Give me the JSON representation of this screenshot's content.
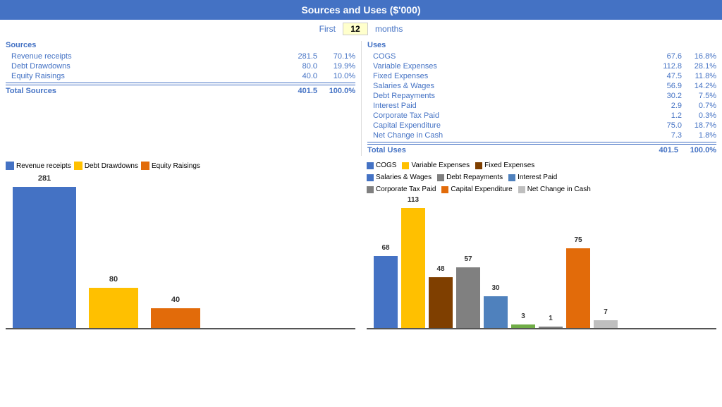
{
  "title": "Sources and Uses ($'000)",
  "months_label_pre": "First",
  "months_value": "12",
  "months_label_post": "months",
  "sources": {
    "header": "Sources",
    "items": [
      {
        "label": "Revenue receipts",
        "value": "281.5",
        "pct": "70.1%"
      },
      {
        "label": "Debt Drawdowns",
        "value": "80.0",
        "pct": "19.9%"
      },
      {
        "label": "Equity Raisings",
        "value": "40.0",
        "pct": "10.0%"
      }
    ],
    "total_label": "Total Sources",
    "total_value": "401.5",
    "total_pct": "100.0%"
  },
  "uses": {
    "header": "Uses",
    "items": [
      {
        "label": "COGS",
        "value": "67.6",
        "pct": "16.8%"
      },
      {
        "label": "Variable Expenses",
        "value": "112.8",
        "pct": "28.1%"
      },
      {
        "label": "Fixed Expenses",
        "value": "47.5",
        "pct": "11.8%"
      },
      {
        "label": "Salaries & Wages",
        "value": "56.9",
        "pct": "14.2%"
      },
      {
        "label": "Debt Repayments",
        "value": "30.2",
        "pct": "7.5%"
      },
      {
        "label": "Interest Paid",
        "value": "2.9",
        "pct": "0.7%"
      },
      {
        "label": "Corporate Tax Paid",
        "value": "1.2",
        "pct": "0.3%"
      },
      {
        "label": "Capital Expenditure",
        "value": "75.0",
        "pct": "18.7%"
      },
      {
        "label": "Net Change in Cash",
        "value": "7.3",
        "pct": "1.8%"
      }
    ],
    "total_label": "Total Uses",
    "total_value": "401.5",
    "total_pct": "100.0%"
  },
  "left_chart": {
    "legend": [
      {
        "label": "Revenue receipts",
        "color": "#4472C4"
      },
      {
        "label": "Debt Drawdowns",
        "color": "#FFC000"
      },
      {
        "label": "Equity Raisings",
        "color": "#E26B0A"
      }
    ],
    "bars": [
      {
        "label": "281",
        "value": 281,
        "color": "#4472C4",
        "width": 90
      },
      {
        "label": "80",
        "value": 80,
        "color": "#FFC000",
        "width": 70
      },
      {
        "label": "40",
        "value": 40,
        "color": "#E26B0A",
        "width": 70
      }
    ]
  },
  "right_chart": {
    "legend": [
      {
        "label": "COGS",
        "color": "#4472C4"
      },
      {
        "label": "Variable Expenses",
        "color": "#FFC000"
      },
      {
        "label": "Fixed Expenses",
        "color": "#7F3F00"
      },
      {
        "label": "Salaries & Wages",
        "color": "#4472C4"
      },
      {
        "label": "Debt Repayments",
        "color": "#808080"
      },
      {
        "label": "Interest Paid",
        "color": "#4F81BD"
      },
      {
        "label": "Corporate Tax Paid",
        "color": "#808080"
      },
      {
        "label": "Capital Expenditure",
        "color": "#E26B0A"
      },
      {
        "label": "Net Change in Cash",
        "color": "#BFBFBF"
      }
    ],
    "bars": [
      {
        "label": "68",
        "value": 68,
        "color": "#4472C4"
      },
      {
        "label": "113",
        "value": 113,
        "color": "#FFC000"
      },
      {
        "label": "48",
        "value": 48,
        "color": "#7F3F00"
      },
      {
        "label": "57",
        "value": 57,
        "color": "#808080"
      },
      {
        "label": "30",
        "value": 30,
        "color": "#4F81BD"
      },
      {
        "label": "3",
        "value": 3,
        "color": "#70AD47"
      },
      {
        "label": "1",
        "value": 1,
        "color": "#808080"
      },
      {
        "label": "75",
        "value": 75,
        "color": "#E26B0A"
      },
      {
        "label": "7",
        "value": 7,
        "color": "#BFBFBF"
      }
    ]
  }
}
